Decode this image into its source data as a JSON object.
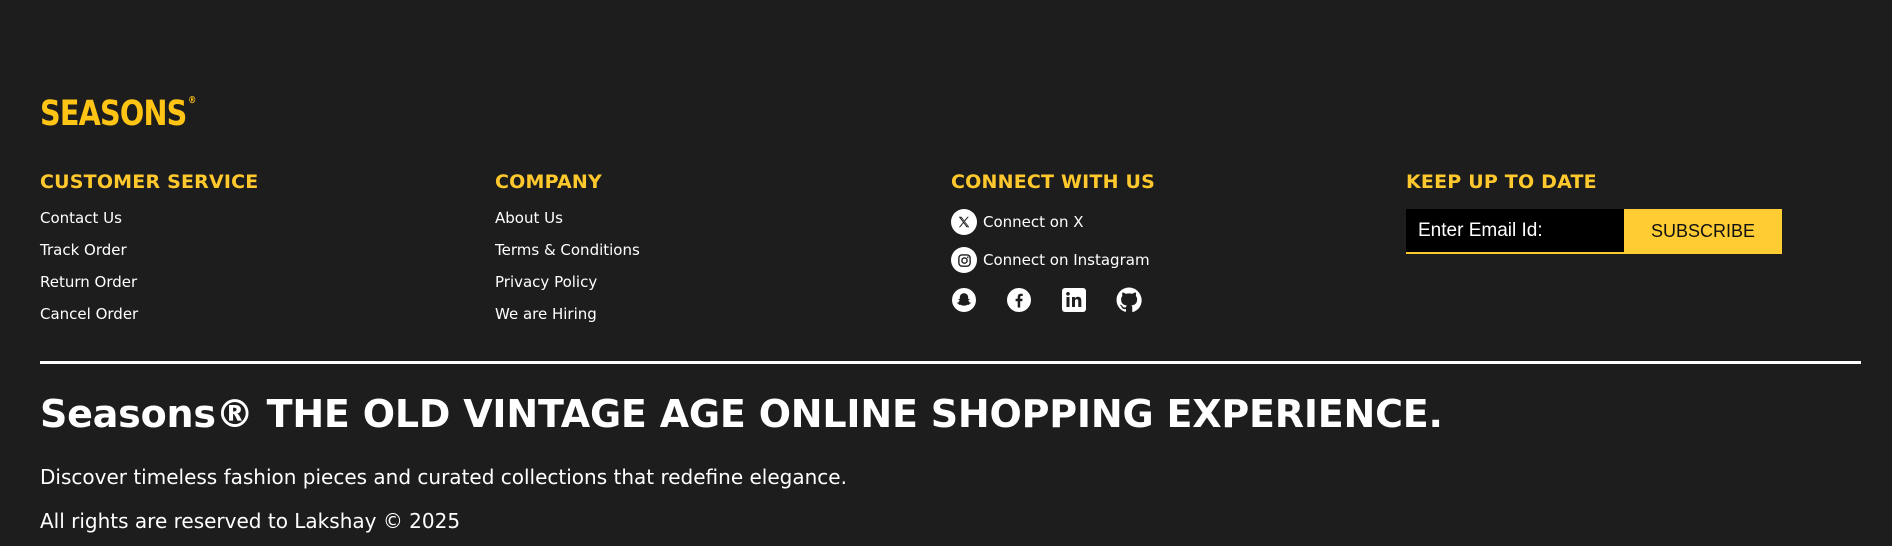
{
  "brand": {
    "logo_text": "SEASONS",
    "logo_mark": "®",
    "accent_color": "#ffc414"
  },
  "columns": {
    "customer_service": {
      "heading": "CUSTOMER SERVICE",
      "links": [
        "Contact Us",
        "Track Order",
        "Return Order",
        "Cancel Order"
      ]
    },
    "company": {
      "heading": "COMPANY",
      "links": [
        "About Us",
        "Terms & Conditions",
        "Privacy Policy",
        "We are Hiring"
      ]
    },
    "connect": {
      "heading": "CONNECT WITH US",
      "links": [
        {
          "label": "Connect on X",
          "icon": "x-icon"
        },
        {
          "label": "Connect on Instagram",
          "icon": "instagram-icon"
        }
      ],
      "social_icons": [
        "snapchat-icon",
        "facebook-icon",
        "linkedin-icon",
        "github-icon"
      ]
    },
    "newsletter": {
      "heading": "KEEP UP TO DATE",
      "email_placeholder": "Enter Email Id:",
      "email_value": "",
      "button_label": "SUBSCRIBE",
      "button_color": "#ffcd33"
    }
  },
  "tagline": "Seasons® THE OLD VINTAGE AGE ONLINE SHOPPING EXPERIENCE.",
  "description": "Discover timeless fashion pieces and curated collections that redefine elegance.",
  "copyright": "All rights are reserved to Lakshay © 2025"
}
